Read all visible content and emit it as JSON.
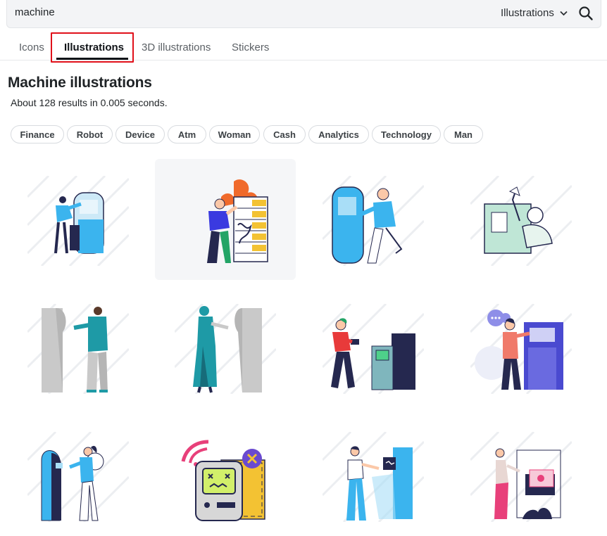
{
  "search": {
    "query": "machine",
    "type": "Illustrations"
  },
  "tabs": [
    {
      "label": "Icons"
    },
    {
      "label": "Illustrations"
    },
    {
      "label": "3D illustrations"
    },
    {
      "label": "Stickers"
    }
  ],
  "main": {
    "title": "Machine illustrations",
    "results": "About 128 results in 0.005 seconds."
  },
  "chips": [
    "Finance",
    "Robot",
    "Device",
    "Atm",
    "Woman",
    "Cash",
    "Analytics",
    "Technology",
    "Man"
  ],
  "colors": {
    "accent_red": "#e0101a",
    "sky_blue": "#3bb4ee",
    "navy": "#25284f",
    "teal": "#1e9aa6",
    "yellow": "#f3c233",
    "pink": "#e8407a",
    "mint": "#bfe6d6"
  },
  "illustrations": [
    {
      "name": "person-repairing-atm-illustration"
    },
    {
      "name": "person-by-burning-server-illustration"
    },
    {
      "name": "person-using-atm-illustration"
    },
    {
      "name": "person-at-kiosk-illustration"
    },
    {
      "name": "man-at-atm-illustration"
    },
    {
      "name": "woman-at-atm-illustration"
    },
    {
      "name": "woman-inserting-card-illustration"
    },
    {
      "name": "man-at-cash-machine-illustration"
    },
    {
      "name": "person-with-atm-illustration"
    },
    {
      "name": "broken-arcade-machine-illustration"
    },
    {
      "name": "person-using-terminal-illustration"
    },
    {
      "name": "woman-with-cash-machine-illustration"
    }
  ]
}
